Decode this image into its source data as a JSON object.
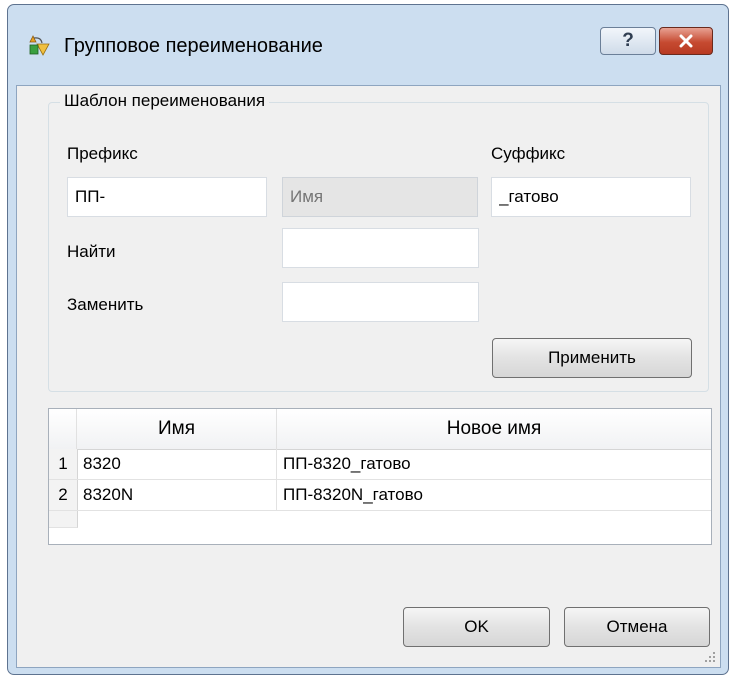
{
  "window": {
    "title": "Групповое переименование",
    "help_label": "?"
  },
  "template_group": {
    "title": "Шаблон переименования",
    "prefix_label": "Префикс",
    "prefix_value": "ПП-",
    "name_placeholder": "Имя",
    "suffix_label": "Суффикс",
    "suffix_value": "_гатово",
    "find_label": "Найти",
    "find_value": "",
    "replace_label": "Заменить",
    "replace_value": "",
    "apply_label": "Применить"
  },
  "table": {
    "columns": [
      "Имя",
      "Новое имя"
    ],
    "rows": [
      {
        "num": "1",
        "name": "8320",
        "new_name": "ПП-8320_гатово"
      },
      {
        "num": "2",
        "name": "8320N",
        "new_name": "ПП-8320N_гатово"
      }
    ]
  },
  "footer": {
    "ok_label": "OK",
    "cancel_label": "Отмена"
  },
  "icons": {
    "app": "rename-icon",
    "close": "close-icon",
    "grip": "resize-grip-icon"
  },
  "colors": {
    "frame": "#ccdef0",
    "close_button": "#c64a31",
    "client_bg": "#f0f0f0"
  }
}
